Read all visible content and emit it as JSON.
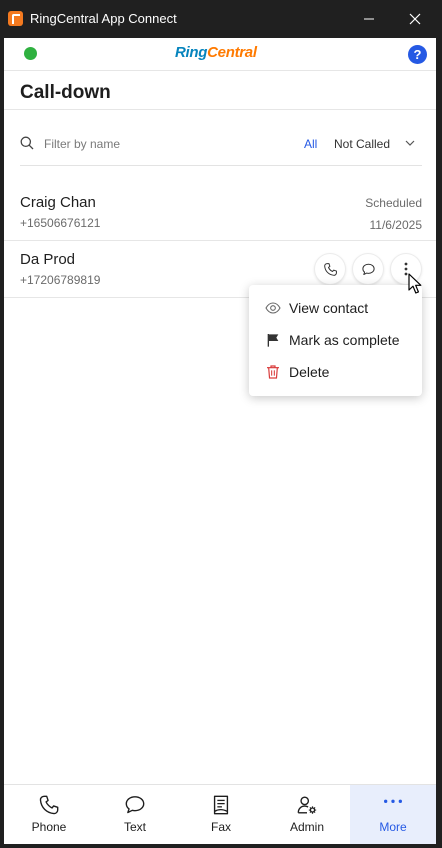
{
  "window": {
    "title": "RingCentral App Connect",
    "icon": "ringcentral-app-icon",
    "controls": [
      "minimize-icon",
      "maximize-icon",
      "close-icon"
    ]
  },
  "header": {
    "status_color": "#2fb140",
    "logo_ring": "Ring",
    "logo_central": "Central",
    "help_label": "?"
  },
  "page": {
    "title": "Call-down"
  },
  "filter": {
    "placeholder": "Filter by name",
    "all_label": "All",
    "selected_option": "Not Called"
  },
  "contacts": [
    {
      "name": "Craig Chan",
      "phone": "+16506676121",
      "status": "Scheduled",
      "date": "11/6/2025"
    },
    {
      "name": "Da Prod",
      "phone": "+17206789819"
    }
  ],
  "context_menu": {
    "items": [
      {
        "label": "View contact",
        "icon": "eye-icon"
      },
      {
        "label": "Mark as complete",
        "icon": "flag-icon"
      },
      {
        "label": "Delete",
        "icon": "trash-icon"
      }
    ]
  },
  "bottom_nav": {
    "items": [
      {
        "label": "Phone",
        "icon": "phone-icon"
      },
      {
        "label": "Text",
        "icon": "chat-bubble-icon"
      },
      {
        "label": "Fax",
        "icon": "fax-document-icon"
      },
      {
        "label": "Admin",
        "icon": "admin-user-gear-icon"
      },
      {
        "label": "More",
        "icon": "more-dots-icon",
        "active": true
      }
    ]
  },
  "colors": {
    "accent": "#2559e4",
    "logo_blue": "#0684bd",
    "logo_orange": "#ff7a00",
    "delete_red": "#d93c3c",
    "active_nav_bg": "#e8eefc"
  }
}
